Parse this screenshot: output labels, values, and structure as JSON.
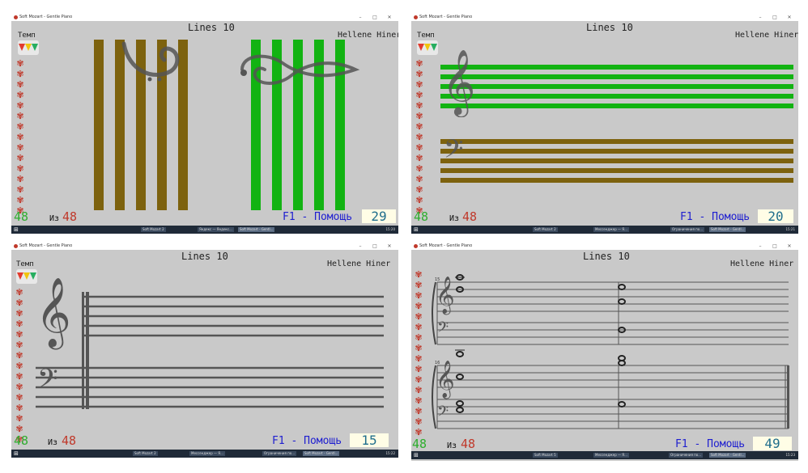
{
  "app": {
    "window_title": "Soft Mozart - Gentle Piano"
  },
  "colors": {
    "brown": "#7d620e",
    "green": "#12b312",
    "staff_gray": "#555555"
  },
  "panels": [
    {
      "lines_title": "Lines 10",
      "author": "Hellene Hiner",
      "tempo_label": "Темп",
      "score_left": "48",
      "iz_label": "Из",
      "score_total": "48",
      "help": "F1 - Помощь",
      "counter": "29",
      "taskbar_items": [
        "Soft Mozart 2",
        "Яндекс — Яндекс...",
        "Soft Mozart - Gentl..."
      ],
      "clock": "15:20"
    },
    {
      "lines_title": "Lines 10",
      "author": "Hellene Hiner",
      "tempo_label": "Темп",
      "score_left": "48",
      "iz_label": "Из",
      "score_total": "48",
      "help": "F1 - Помощь",
      "counter": "20",
      "taskbar_items": [
        "Soft Mozart 2",
        "Мессенджер — Я...",
        "Ограничения по...",
        "Soft Mozart - Gentl..."
      ],
      "clock": "15:21"
    },
    {
      "lines_title": "Lines 10",
      "author": "Hellene Hiner",
      "tempo_label": "Темп",
      "score_left": "48",
      "iz_label": "Из",
      "score_total": "48",
      "help": "F1 - Помощь",
      "counter": "15",
      "taskbar_items": [
        "Soft Mozart 2",
        "Мессенджер — Я...",
        "Ограничения по...",
        "Soft Mozart - Gentl..."
      ],
      "clock": "15:22"
    },
    {
      "lines_title": "Lines 10",
      "author": "Hellene Hiner",
      "score_left": "48",
      "iz_label": "Из",
      "score_total": "48",
      "help": "F1 - Помощь",
      "counter": "49",
      "measure_top": "15",
      "measure_bottom": "16",
      "taskbar_items": [
        "Soft Mozart 5",
        "Мессенджер — Я...",
        "Ограничения по...",
        "Soft Mozart - Gentl..."
      ],
      "clock": "15:23"
    }
  ]
}
